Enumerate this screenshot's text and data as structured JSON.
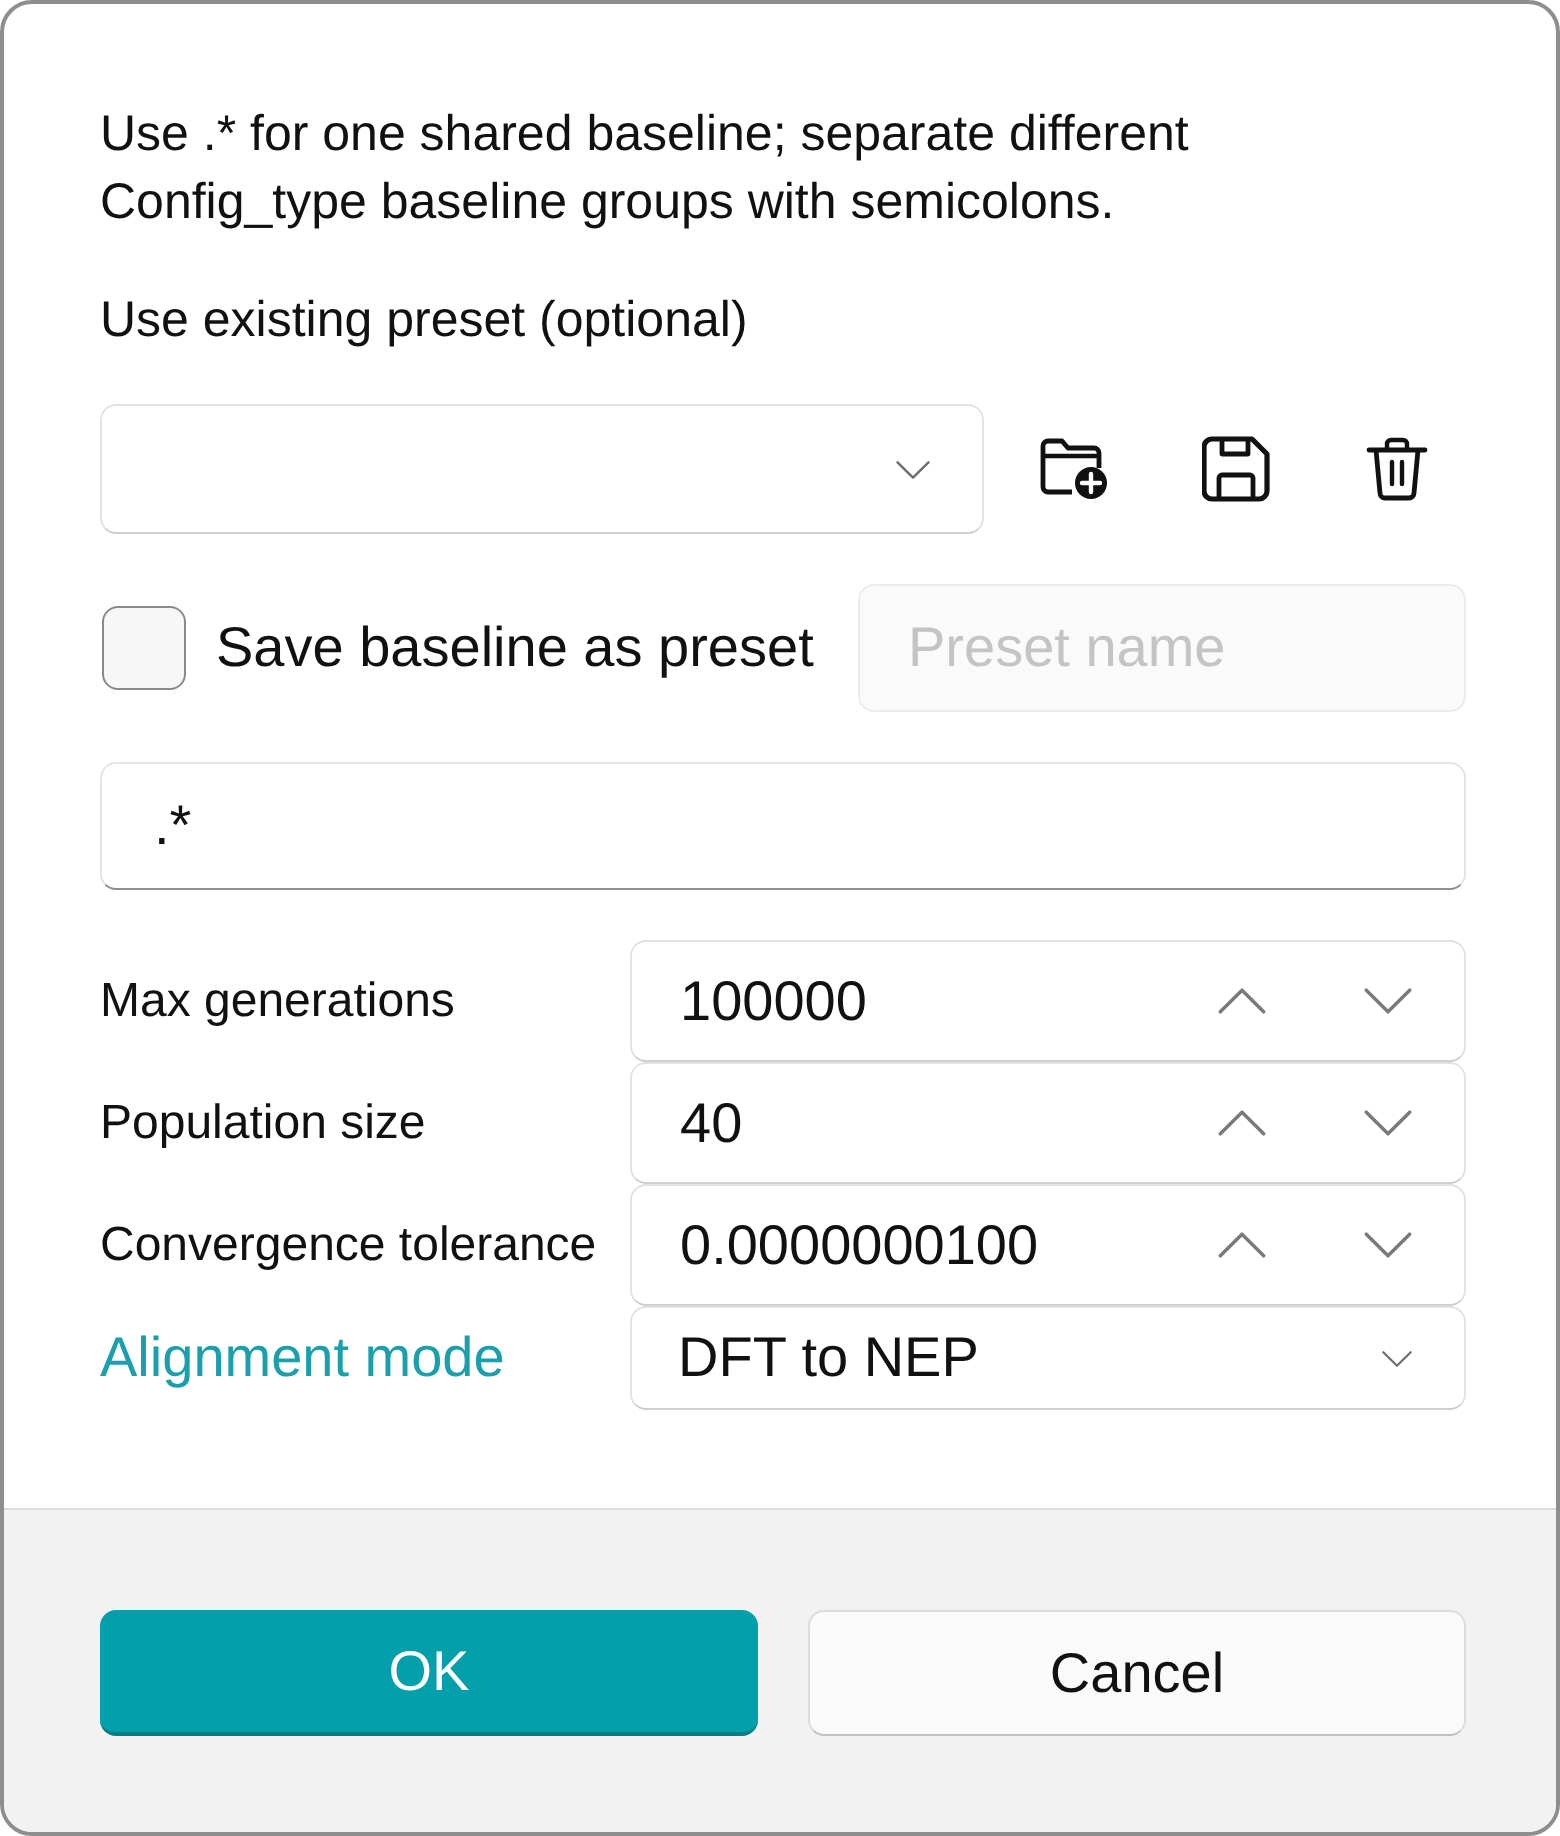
{
  "instructions": "Use .* for one shared baseline; separate different Config_type baseline groups with semicolons.",
  "preset": {
    "label": "Use existing preset (optional)"
  },
  "save_as_preset": {
    "label": "Save baseline as preset",
    "checked": false,
    "name_field": {
      "placeholder": "Preset name"
    }
  },
  "baseline_field": {
    "value": ".*"
  },
  "parameters": [
    {
      "kind": "spin",
      "label": "Max generations",
      "value": "100000",
      "highlighted": false
    },
    {
      "kind": "spin",
      "label": "Population size",
      "value": "40",
      "highlighted": false
    },
    {
      "kind": "spin",
      "label": "Convergence tolerance",
      "value": "0.0000000100",
      "highlighted": false
    },
    {
      "kind": "combo",
      "label": "Alignment mode",
      "value": "DFT to NEP",
      "highlighted": true
    }
  ],
  "buttons": [
    {
      "kind": "primary",
      "label": "OK"
    },
    {
      "kind": "secondary",
      "label": "Cancel"
    }
  ]
}
